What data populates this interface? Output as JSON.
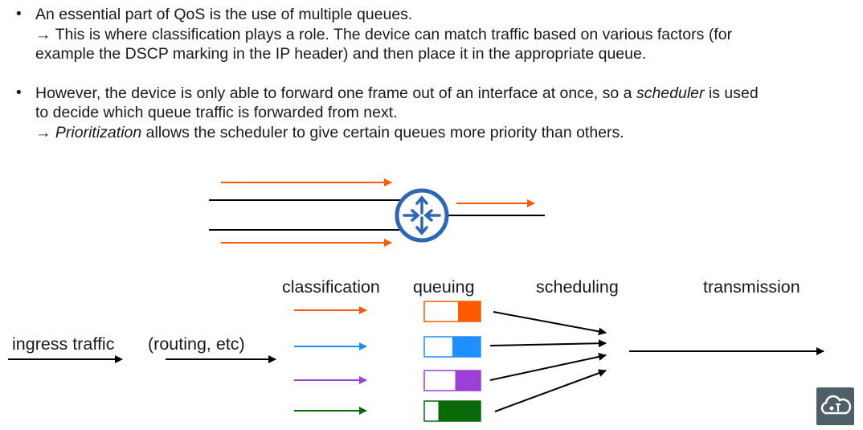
{
  "bullets": [
    {
      "line1": "An essential part of QoS is the use of multiple queues.",
      "arrow": "→",
      "line2": "This is where classification plays a role.  The device can match traffic based on various factors (for",
      "line3": "example the DSCP marking in the IP header) and then place it in the appropriate queue."
    },
    {
      "line1_pre": "However, the device is only able to forward one frame out of an interface at once, so a ",
      "line1_em": "scheduler",
      "line1_post": " is used",
      "line2": "to decide which queue traffic is forwarded from next.",
      "arrow": "→",
      "line3_em": "Prioritization",
      "line3_post": " allows the scheduler to give certain queues more priority than others."
    }
  ],
  "stages": {
    "ingress": "ingress traffic",
    "routing": "(routing, etc)",
    "classification": "classification",
    "queuing": "queuing",
    "scheduling": "scheduling",
    "transmission": "transmission"
  },
  "queues": [
    {
      "name": "orange",
      "color": "#ff5a00",
      "fill": 0.4
    },
    {
      "name": "blue",
      "color": "#1e8fff",
      "fill": 0.5
    },
    {
      "name": "purple",
      "color": "#9b3fd6",
      "fill": 0.45
    },
    {
      "name": "green",
      "color": "#0a6a0a",
      "fill": 0.75
    }
  ],
  "colors": {
    "router": "#2f65b5",
    "arrow_top": "#ff5a00",
    "line": "#000000"
  },
  "icons": [
    "router-icon",
    "cloud-logo-icon"
  ]
}
